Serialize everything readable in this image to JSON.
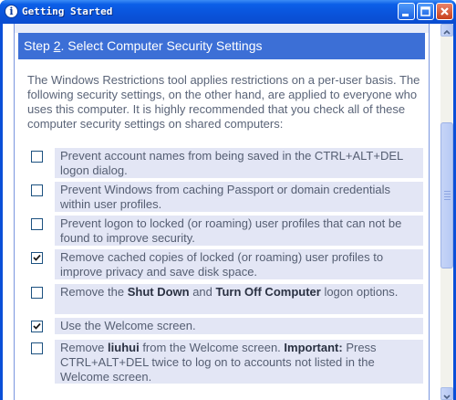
{
  "window": {
    "title": "Getting Started",
    "icon": "info-icon",
    "controls": [
      "minimize-icon",
      "maximize-icon",
      "close-icon"
    ]
  },
  "step": {
    "prefix": "Step ",
    "number": "2",
    "title": ". Select Computer Security Settings"
  },
  "intro": "The Windows Restrictions tool applies restrictions on a per-user basis. The following security settings, on the other hand, are applied to everyone who uses this computer. It is highly recommended that you check all of these computer security settings on shared computers:",
  "options": [
    {
      "parts": [
        {
          "text": "Prevent account names from being saved in the CTRL+ALT+DEL logon dialog."
        }
      ],
      "checked": false
    },
    {
      "parts": [
        {
          "text": "Prevent Windows from caching Passport or domain credentials within user profiles."
        }
      ],
      "checked": false
    },
    {
      "parts": [
        {
          "text": "Prevent logon to locked (or roaming) user profiles that can not be found to improve security."
        }
      ],
      "checked": false
    },
    {
      "parts": [
        {
          "text": "Remove cached copies of locked (or roaming) user profiles to improve privacy and save disk space."
        }
      ],
      "checked": true
    },
    {
      "parts": [
        {
          "text": "Remove the "
        },
        {
          "text": "Shut Down",
          "bold": true
        },
        {
          "text": " and "
        },
        {
          "text": "Turn Off Computer",
          "bold": true
        },
        {
          "text": " logon options."
        }
      ],
      "checked": false
    },
    {
      "parts": [
        {
          "text": "Use the Welcome screen."
        }
      ],
      "checked": true
    },
    {
      "parts": [
        {
          "text": "Remove "
        },
        {
          "text": "liuhui",
          "bold": true
        },
        {
          "text": " from the Welcome screen. "
        },
        {
          "text": "Important:",
          "bold": true
        },
        {
          "text": " Press CTRL+ALT+DEL twice to log on to accounts not listed in the Welcome screen."
        }
      ],
      "checked": false
    }
  ],
  "scrollbar": {
    "position": 0.42
  }
}
